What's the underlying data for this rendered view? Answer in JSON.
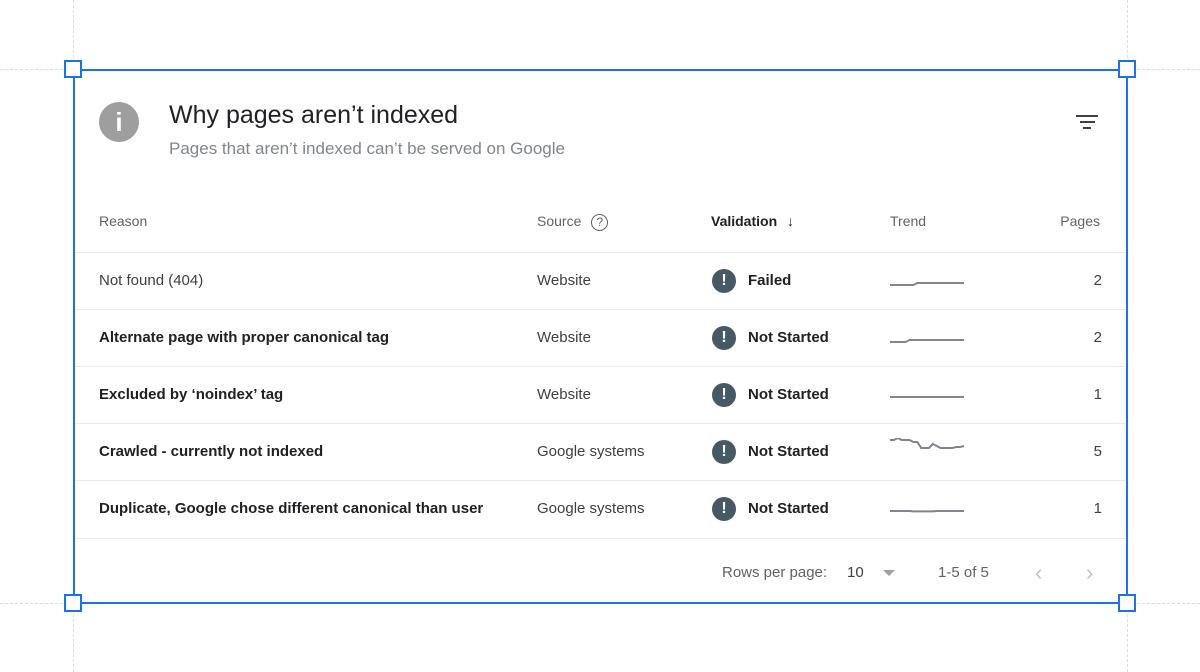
{
  "card": {
    "title": "Why pages aren’t indexed",
    "subtitle": "Pages that aren’t indexed can’t be served on Google",
    "info_icon": "info-icon",
    "filter_icon": "filter-icon"
  },
  "table": {
    "headers": {
      "reason": "Reason",
      "source": "Source",
      "validation": "Validation",
      "trend": "Trend",
      "pages": "Pages"
    },
    "sort_icon": "arrow-down-icon",
    "rows": [
      {
        "reason": "Not found (404)",
        "source": "Website",
        "validation": "Failed",
        "trend": [
          0,
          0,
          0,
          0,
          0,
          0,
          0,
          1,
          1,
          1,
          1,
          1,
          1,
          1,
          1,
          1,
          1,
          1,
          1,
          1
        ],
        "pages": "2"
      },
      {
        "reason": "Alternate page with proper canonical tag",
        "source": "Website",
        "validation": "Not Started",
        "trend": [
          0,
          0,
          0,
          0,
          0,
          1,
          1,
          1,
          1,
          1,
          1,
          1,
          1,
          1,
          1,
          1,
          1,
          1,
          1,
          1
        ],
        "pages": "2"
      },
      {
        "reason": "Excluded by ‘noindex’ tag",
        "source": "Website",
        "validation": "Not Started",
        "trend": [
          1,
          1,
          1,
          1,
          1,
          1,
          1,
          1,
          1,
          1,
          1,
          1,
          1,
          1,
          1,
          1,
          1,
          1,
          1,
          1
        ],
        "pages": "1"
      },
      {
        "reason": "Crawled - currently not indexed",
        "source": "Google systems",
        "validation": "Not Started",
        "trend": [
          8,
          8,
          9,
          8,
          8,
          8,
          7,
          7,
          4,
          4,
          4,
          6,
          5,
          4,
          4,
          4,
          4,
          4.5,
          4.5,
          5
        ],
        "pages": "5"
      },
      {
        "reason": "Duplicate, Google chose different canonical than user",
        "source": "Google systems",
        "validation": "Not Started",
        "trend": [
          1,
          1,
          1,
          1,
          1,
          1,
          0.8,
          0.8,
          0.8,
          0.8,
          0.8,
          0.8,
          1,
          1,
          1,
          1,
          1,
          1,
          1,
          1
        ],
        "pages": "1"
      }
    ]
  },
  "footer": {
    "rows_per_page_label": "Rows per page:",
    "rows_per_page_value": "10",
    "range": "1-5 of 5"
  },
  "colors": {
    "selection": "#1a73e8",
    "status_icon": "#455a64",
    "trend_line": "#80868b"
  }
}
